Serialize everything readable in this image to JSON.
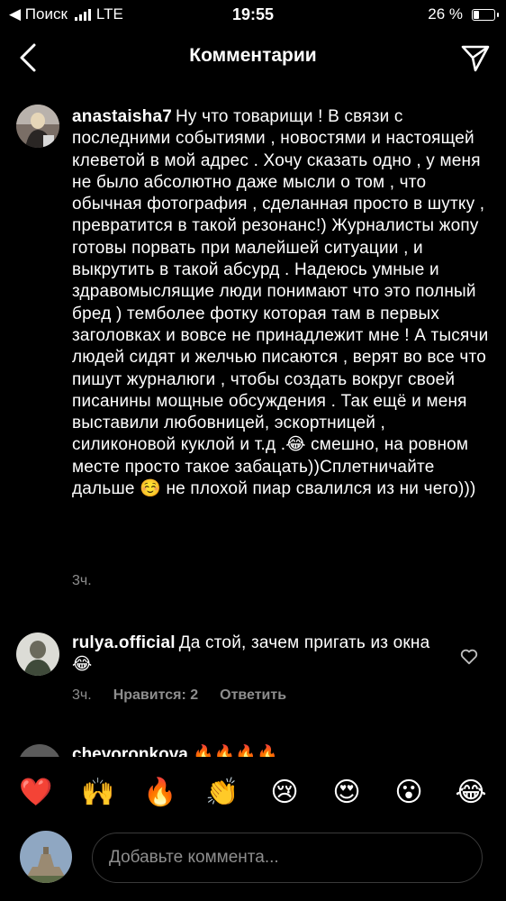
{
  "status_bar": {
    "back_app": "◀ Поиск",
    "network": "LTE",
    "time": "19:55",
    "battery_percent": "26 %",
    "battery_level": 0.26
  },
  "nav": {
    "title": "Комментарии",
    "back_icon": "chevron-left-icon",
    "send_icon": "paper-plane-icon"
  },
  "comments": [
    {
      "username": "anastaisha7",
      "text": "Ну что товарищи ! В связи с последними событиями , новостями и настоящей клеветой в мой адрес . Хочу сказать одно , у меня не было абсолютно даже мысли о том , что обычная фотография , сделанная просто в шутку , превратится в такой резонанс!) Журналисты жопу готовы порвать при малейшей ситуации , и выкрутить в такой абсурд . Надеюсь умные и здравомыслящие люди понимают что это полный бред ) темболее фотку которая там в первых заголовках и вовсе не принадлежит мне ! А тысячи людей сидят и желчью писаются , верят во все что пишут журналюги , чтобы создать вокруг своей писанины мощные обсуждения . Так ещё и меня выставили любовницей, эскортницей , силиконовой куклой и т.д .😂 смешно, на ровном месте просто такое забацать))Сплетничайте дальше ☺️ не плохой пиар свалился из ни чего)))",
      "time": "3ч."
    },
    {
      "username": "rulya.official",
      "text": "Да стой, зачем пригать из окна 😂",
      "time": "3ч.",
      "likes": "Нравится: 2",
      "reply": "Ответить"
    },
    {
      "username": "chevoronkova",
      "text": "🔥🔥🔥🔥"
    }
  ],
  "emoji_bar": [
    "❤️",
    "🙌",
    "🔥",
    "👏",
    "😢",
    "😍",
    "😮",
    "😂"
  ],
  "composer": {
    "placeholder": "Добавьте коммента..."
  }
}
